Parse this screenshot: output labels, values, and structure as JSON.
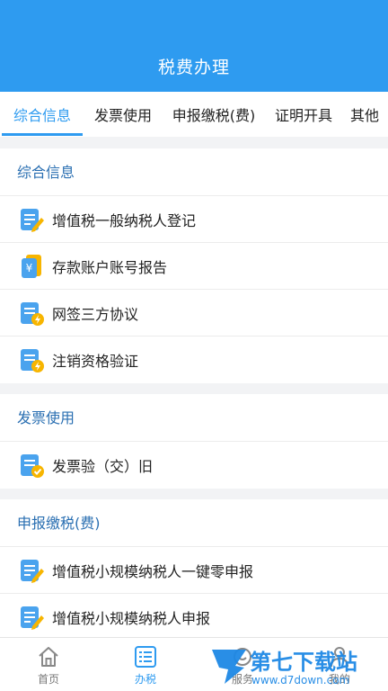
{
  "header": {
    "title": "税费办理"
  },
  "tabs": [
    {
      "label": "综合信息"
    },
    {
      "label": "发票使用"
    },
    {
      "label": "申报缴税(费)"
    },
    {
      "label": "证明开具"
    },
    {
      "label": "其他"
    }
  ],
  "sections": [
    {
      "title": "综合信息",
      "items": [
        {
          "label": "增值税一般纳税人登记",
          "icon": "doc-edit-icon"
        },
        {
          "label": "存款账户账号报告",
          "icon": "yuan-card-icon"
        },
        {
          "label": "网签三方协议",
          "icon": "doc-lightning-icon"
        },
        {
          "label": "注销资格验证",
          "icon": "doc-lightning-icon"
        }
      ]
    },
    {
      "title": "发票使用",
      "items": [
        {
          "label": "发票验（交）旧",
          "icon": "doc-check-icon"
        }
      ]
    },
    {
      "title": "申报缴税(费)",
      "items": [
        {
          "label": "增值税小规模纳税人一键零申报",
          "icon": "doc-edit-icon"
        },
        {
          "label": "增值税小规模纳税人申报",
          "icon": "doc-edit-icon"
        }
      ]
    }
  ],
  "bottom_nav": [
    {
      "label": "首页",
      "icon": "home-icon"
    },
    {
      "label": "办税",
      "icon": "list-icon"
    },
    {
      "label": "服务",
      "icon": "service-icon"
    },
    {
      "label": "我的",
      "icon": "user-icon"
    }
  ],
  "watermark": {
    "brand": "第七下载站",
    "url": "www.d7down.com"
  },
  "colors": {
    "primary": "#2e9bf0",
    "section_title": "#2a6fb2",
    "icon_yellow": "#f7b500"
  }
}
